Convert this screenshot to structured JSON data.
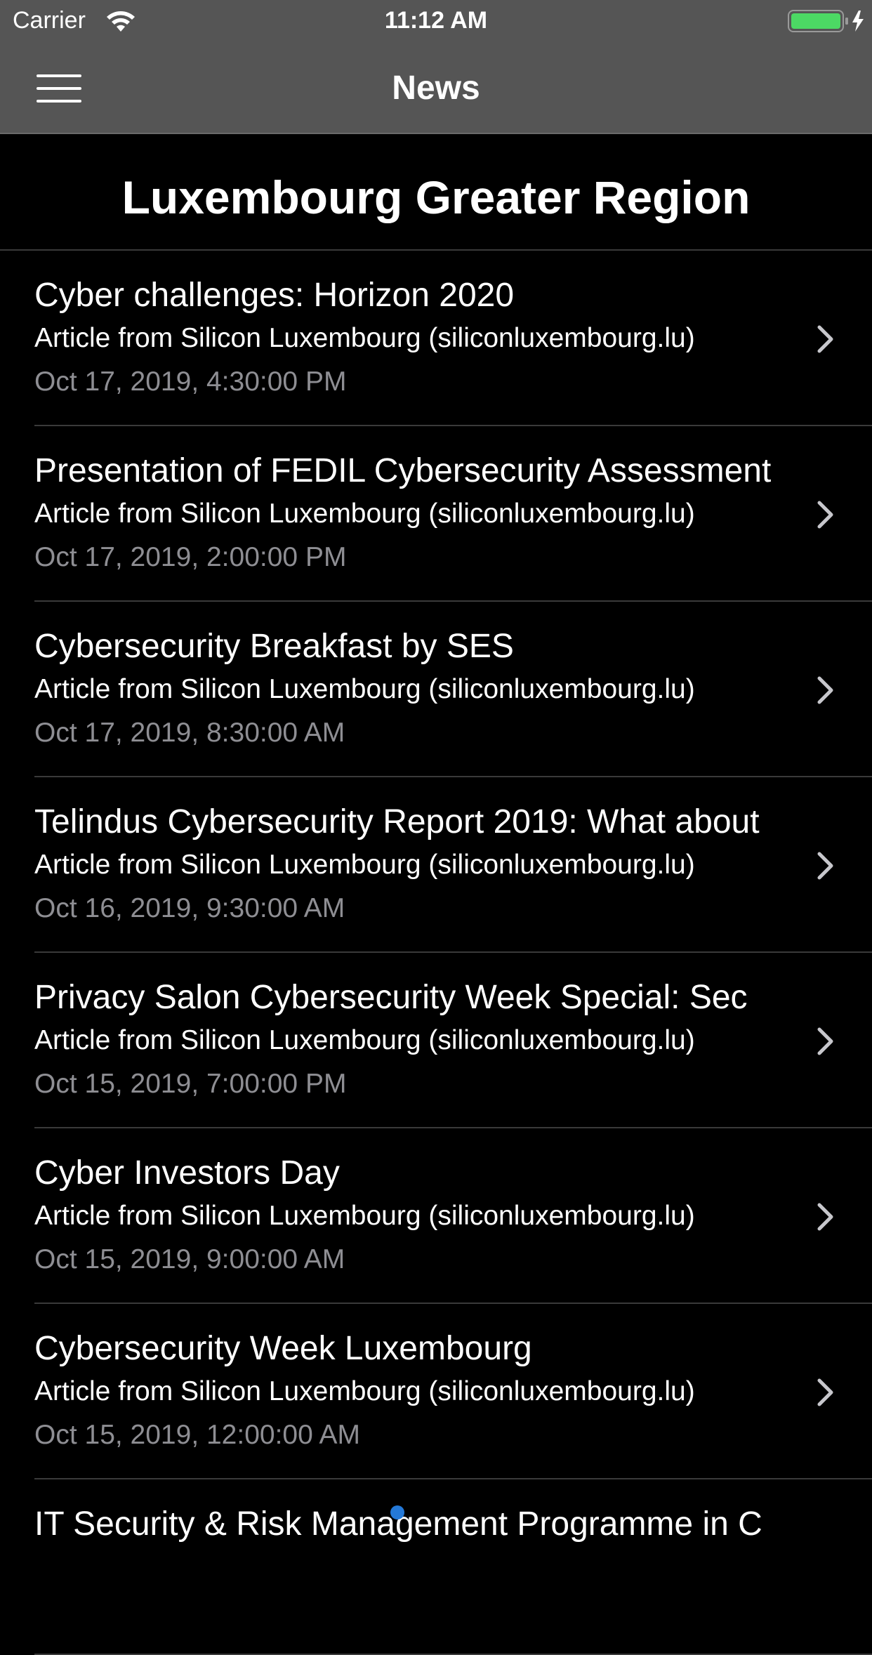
{
  "status_bar": {
    "carrier": "Carrier",
    "time": "11:12 AM",
    "battery_color": "#4cd964"
  },
  "nav": {
    "title": "News",
    "menu_icon": "hamburger-menu-icon"
  },
  "section": {
    "title": "Luxembourg Greater Region"
  },
  "news": [
    {
      "title": "Cyber challenges: Horizon 2020",
      "source": "Article from Silicon Luxembourg (siliconluxembourg.lu)",
      "date": "Oct 17, 2019, 4:30:00 PM"
    },
    {
      "title": "Presentation of FEDIL Cybersecurity Assessment",
      "source": "Article from Silicon Luxembourg (siliconluxembourg.lu)",
      "date": "Oct 17, 2019, 2:00:00 PM"
    },
    {
      "title": "Cybersecurity Breakfast by SES",
      "source": "Article from Silicon Luxembourg (siliconluxembourg.lu)",
      "date": "Oct 17, 2019, 8:30:00 AM"
    },
    {
      "title": "Telindus Cybersecurity Report 2019: What about",
      "source": "Article from Silicon Luxembourg (siliconluxembourg.lu)",
      "date": "Oct 16, 2019, 9:30:00 AM"
    },
    {
      "title": "Privacy Salon Cybersecurity Week Special: Sec",
      "source": "Article from Silicon Luxembourg (siliconluxembourg.lu)",
      "date": "Oct 15, 2019, 7:00:00 PM"
    },
    {
      "title": "Cyber Investors Day",
      "source": "Article from Silicon Luxembourg (siliconluxembourg.lu)",
      "date": "Oct 15, 2019, 9:00:00 AM"
    },
    {
      "title": "Cybersecurity Week Luxembourg",
      "source": "Article from Silicon Luxembourg (siliconluxembourg.lu)",
      "date": "Oct 15, 2019, 12:00:00 AM"
    },
    {
      "title": "IT Security & Risk Management Programme in C",
      "source": "",
      "date": ""
    }
  ]
}
